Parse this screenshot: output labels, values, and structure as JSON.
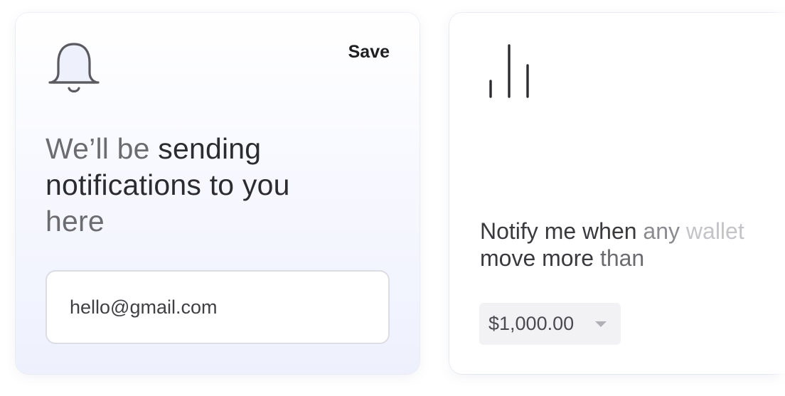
{
  "notification_card": {
    "icon": "bell-icon",
    "save_label": "Save",
    "headline_part1": "We’ll be ",
    "headline_part2": "sending",
    "headline_part3": "notifications to you",
    "headline_part4": "here",
    "email_value": "hello@gmail.com"
  },
  "threshold_card": {
    "icon": "bar-chart-icon",
    "notify_part1": "Notify me when ",
    "notify_part2": "any ",
    "notify_part3": "wallet",
    "notify_line2a": "move more ",
    "notify_line2b": "than",
    "amount_value": "$1,000.00",
    "caret_icon": "chevron-down-icon"
  },
  "colors": {
    "text_dark": "#2c2c30",
    "text_muted": "#6b6b70",
    "card_gradient_end": "#eef1fd",
    "select_bg": "#f2f2f4"
  }
}
